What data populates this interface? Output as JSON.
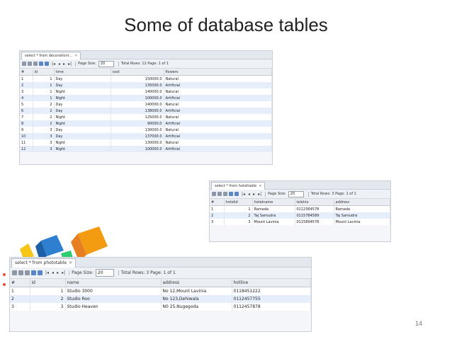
{
  "slide": {
    "title": "Some of database tables",
    "page_number": "14"
  },
  "colors": {
    "grid_alt_row": "#e7eefb",
    "header_bg": "#eaedf2",
    "deco_orange": "#f39c12",
    "deco_blue": "#2f7fd1",
    "deco_yellow": "#f5c518"
  },
  "toolbar": {
    "page_size_label": "Page Size:",
    "page_size_value": "20"
  },
  "decoration_table": {
    "tab_label": "select * from decorationt...",
    "total_rows": "Total Rows: 12",
    "page_info": "Page: 1 of 1",
    "columns": [
      "#",
      "id",
      "time",
      "cost",
      "flowers"
    ],
    "rows": [
      [
        "1",
        "1",
        "Day",
        "150000.0",
        "Natural"
      ],
      [
        "2",
        "1",
        "Day",
        "135000.0",
        "Artificial"
      ],
      [
        "3",
        "1",
        "Night",
        "140000.0",
        "Natural"
      ],
      [
        "4",
        "1",
        "Night",
        "100000.0",
        "Artificial"
      ],
      [
        "5",
        "2",
        "Day",
        "140000.0",
        "Natural"
      ],
      [
        "6",
        "2",
        "Day",
        "138000.0",
        "Artificial"
      ],
      [
        "7",
        "2",
        "Night",
        "125000.0",
        "Natural"
      ],
      [
        "8",
        "2",
        "Night",
        "90000.0",
        "Artificial"
      ],
      [
        "9",
        "3",
        "Day",
        "130000.0",
        "Natural"
      ],
      [
        "10",
        "3",
        "Day",
        "137000.0",
        "Artificial"
      ],
      [
        "11",
        "3",
        "Night",
        "130000.0",
        "Natural"
      ],
      [
        "12",
        "3",
        "Night",
        "100000.0",
        "Artificial"
      ]
    ]
  },
  "hotel_table": {
    "tab_label": "select * from hoteltable",
    "total_rows": "Total Rows: 3",
    "page_info": "Page: 1 of 1",
    "columns": [
      "#",
      "hotelid",
      "hotelname",
      "telehio",
      "address"
    ],
    "rows": [
      [
        "1",
        "1",
        "Ramada",
        "0112364578",
        "Ramada"
      ],
      [
        "2",
        "2",
        "Taj Samudra",
        "0115784589",
        "Taj Samudra"
      ],
      [
        "3",
        "3",
        "Mount Lavinia",
        "0115894578",
        "Mount Lavinia"
      ]
    ]
  },
  "photo_table": {
    "tab_label": "select * from phototable",
    "total_rows": "Total Rows: 3",
    "page_info": "Page: 1 of 1",
    "columns": [
      "#",
      "id",
      "name",
      "address",
      "hotline"
    ],
    "rows": [
      [
        "1",
        "1",
        "Studio 3000",
        "No 12,Mount Lavinia",
        "0118451222"
      ],
      [
        "2",
        "2",
        "Studio Roo",
        "No 123,Dehiwala",
        "0112457755"
      ],
      [
        "3",
        "3",
        "Studio Heaven",
        "N0 25,Nugegoda",
        "0112457878"
      ]
    ]
  }
}
